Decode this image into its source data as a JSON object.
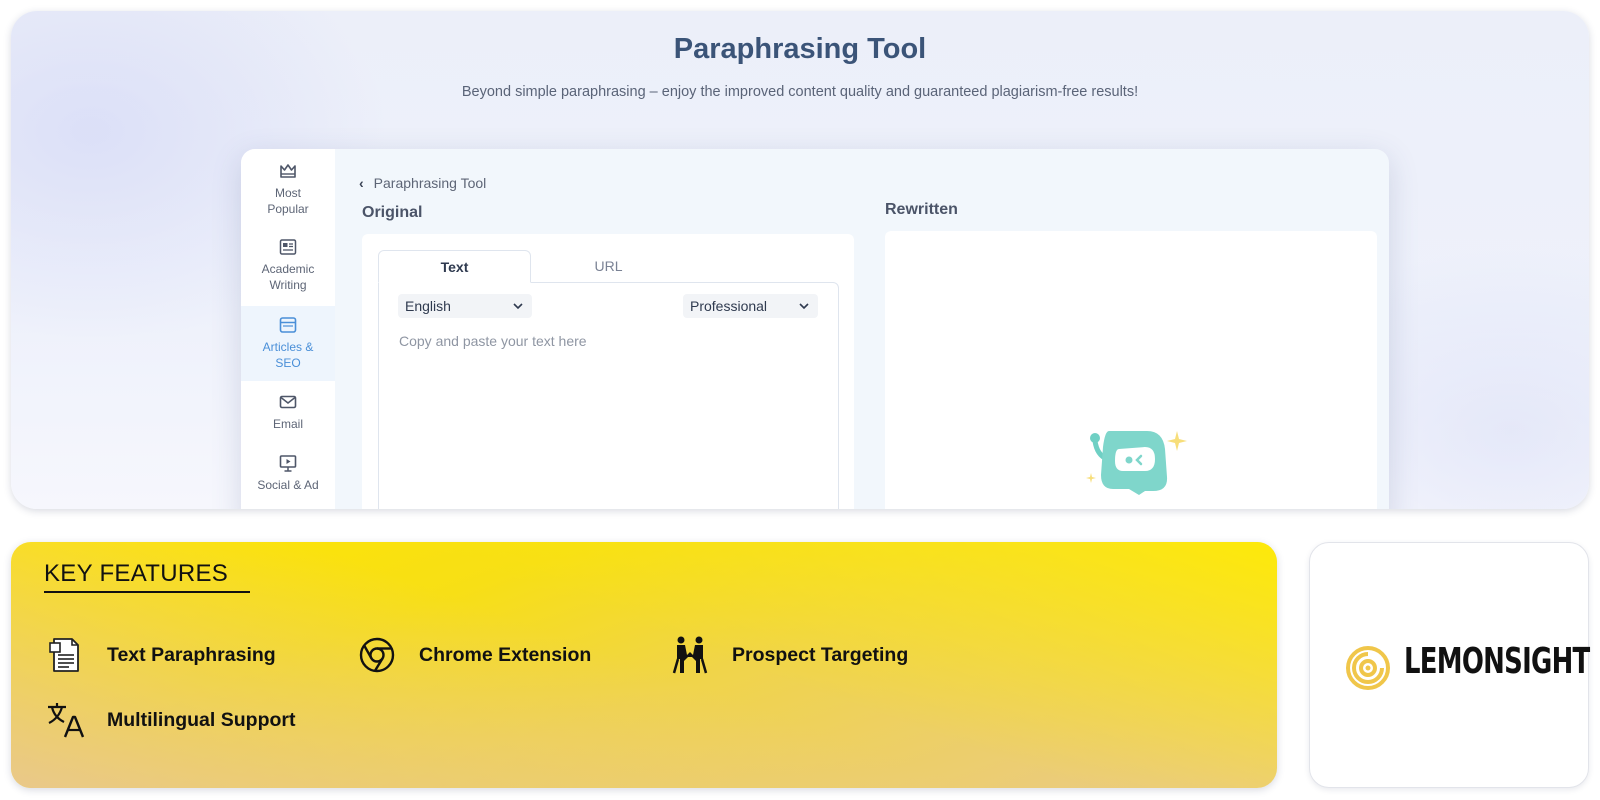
{
  "hero": {
    "title": "Paraphrasing Tool",
    "subtitle": "Beyond simple paraphrasing – enjoy the improved content quality and guaranteed plagiarism-free results!"
  },
  "app": {
    "sidebar": {
      "items": [
        {
          "line1": "Most",
          "line2": "Popular",
          "icon": "crown-icon",
          "active": false
        },
        {
          "line1": "Academic",
          "line2": "Writing",
          "icon": "newspaper-icon",
          "active": false
        },
        {
          "line1": "Articles &",
          "line2": "SEO",
          "icon": "browser-window-icon",
          "active": true
        },
        {
          "line1": "Email",
          "line2": "",
          "icon": "envelope-icon",
          "active": false
        },
        {
          "line1": "Social & Ad",
          "line2": "",
          "icon": "presentation-icon",
          "active": false
        }
      ],
      "active_color": "#4a8fd8"
    },
    "breadcrumb": "Paraphrasing Tool",
    "original_label": "Original",
    "rewritten_label": "Rewritten",
    "tabs": [
      {
        "label": "Text",
        "active": true
      },
      {
        "label": "URL",
        "active": false
      }
    ],
    "language_select": "English",
    "tone_select": "Professional",
    "input_placeholder": "Copy and paste your text here"
  },
  "features": {
    "title": "KEY FEATURES",
    "items": [
      {
        "label": "Text Paraphrasing",
        "icon": "document-icon"
      },
      {
        "label": "Chrome Extension",
        "icon": "chrome-icon"
      },
      {
        "label": "Prospect Targeting",
        "icon": "handshake-people-icon"
      },
      {
        "label": "Multilingual Support",
        "icon": "translate-icon"
      }
    ],
    "background_colors": [
      "#ffe600",
      "#e9c98a"
    ]
  },
  "logo": {
    "word": "LEMONSIGHT",
    "mark_color": "#f0c64a"
  }
}
